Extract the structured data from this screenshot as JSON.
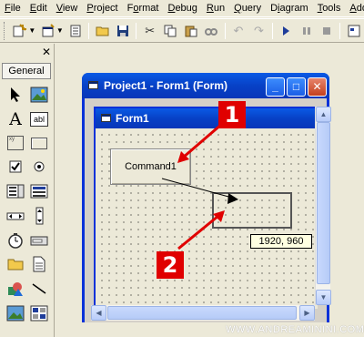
{
  "menubar": {
    "items": [
      {
        "label": "File",
        "ul": "F"
      },
      {
        "label": "Edit",
        "ul": "E"
      },
      {
        "label": "View",
        "ul": "V"
      },
      {
        "label": "Project",
        "ul": "P"
      },
      {
        "label": "Format",
        "ul": "o"
      },
      {
        "label": "Debug",
        "ul": "D"
      },
      {
        "label": "Run",
        "ul": "R"
      },
      {
        "label": "Query",
        "ul": "Q"
      },
      {
        "label": "Diagram",
        "ul": "i"
      },
      {
        "label": "Tools",
        "ul": "T"
      },
      {
        "label": "Add-I",
        "ul": "A"
      }
    ]
  },
  "toolbox": {
    "close_label": "✕",
    "tab_label": "General",
    "text_tool_glyph": "A",
    "textbox_tool_glyph": "abl",
    "frame_tool_glyph": "xy"
  },
  "project_window": {
    "title": "Project1 - Form1 (Form)",
    "minimize_glyph": "_",
    "maximize_glyph": "□",
    "close_glyph": "✕"
  },
  "form": {
    "title": "Form1",
    "command_button_label": "Command1",
    "coordinate_tooltip": "1920, 960"
  },
  "annotations": {
    "badge1": "1",
    "badge2": "2",
    "accent_color": "#e00000"
  },
  "watermark": "WWW.ANDREAMININI.COM"
}
